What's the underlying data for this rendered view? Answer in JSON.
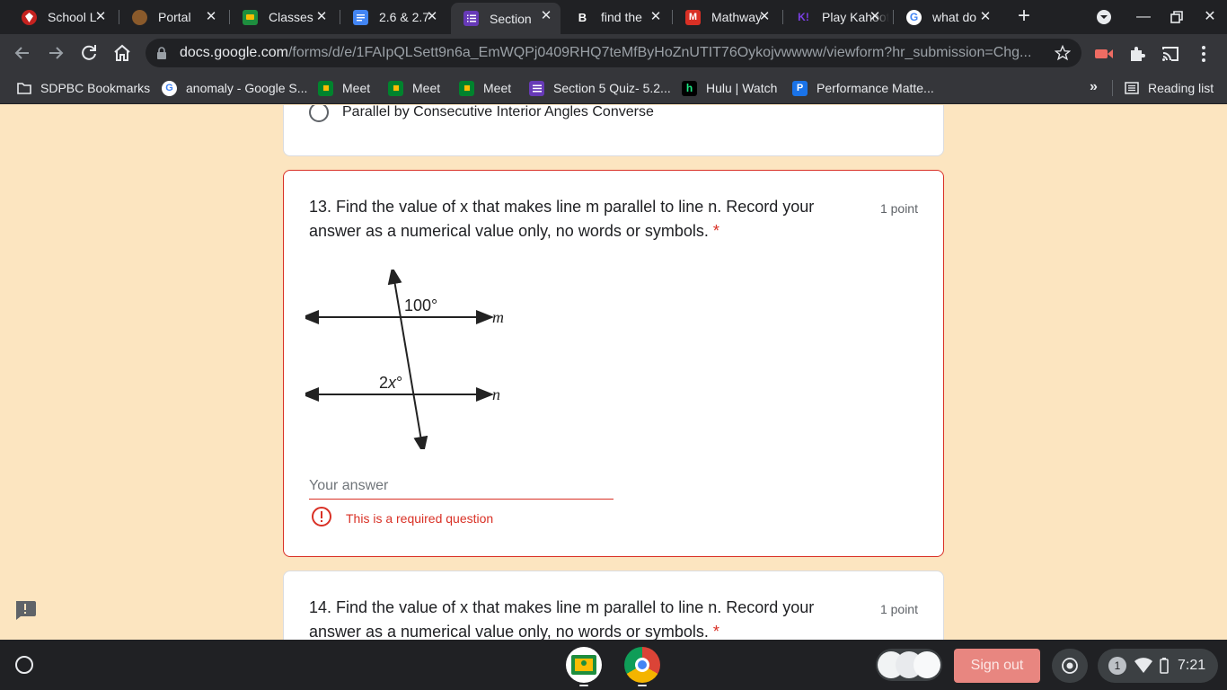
{
  "tabs": [
    {
      "title": "School L",
      "icon": "school-favicon",
      "color": "#c5221f",
      "active": false
    },
    {
      "title": "Portal",
      "icon": "portal-favicon",
      "color": "#8a5a2b",
      "active": false
    },
    {
      "title": "Classes",
      "icon": "classroom-favicon",
      "color": "#1e8e3e",
      "active": false
    },
    {
      "title": "2.6 & 2.7",
      "icon": "docs-favicon",
      "color": "#4285f4",
      "active": false
    },
    {
      "title": "Section",
      "icon": "forms-favicon",
      "color": "#673ab7",
      "active": true
    },
    {
      "title": "find the",
      "icon": "brainly-favicon",
      "color": "#202124",
      "active": false
    },
    {
      "title": "Mathway",
      "icon": "mathway-favicon",
      "color": "#d93025",
      "active": false
    },
    {
      "title": "Play Kahoot",
      "icon": "kahoot-favicon",
      "color": "#46178f",
      "active": false
    },
    {
      "title": "what do",
      "icon": "google-favicon",
      "color": "#ffffff",
      "active": false
    }
  ],
  "url": {
    "host": "docs.google.com",
    "path": "/forms/d/e/1FAIpQLSett9n6a_EmWQPj0409RHQ7teMfByHoZnUTIT76Oykojvwwww/viewform?hr_submission=Chg..."
  },
  "bookmarks": [
    {
      "label": "SDPBC Bookmarks",
      "icon": "folder-icon"
    },
    {
      "label": "anomaly - Google S...",
      "icon": "google-icon"
    },
    {
      "label": "Meet",
      "icon": "meet-icon"
    },
    {
      "label": "Meet",
      "icon": "meet-icon"
    },
    {
      "label": "Meet",
      "icon": "meet-icon"
    },
    {
      "label": "Section 5 Quiz- 5.2...",
      "icon": "forms-icon"
    },
    {
      "label": "Hulu | Watch",
      "icon": "hulu-icon"
    },
    {
      "label": "Performance Matte...",
      "icon": "pm-icon"
    }
  ],
  "bookmarks_more": "»",
  "reading_list": "Reading list",
  "prev_question": {
    "option_label": "Parallel by Consecutive Interior Angles Converse"
  },
  "q13": {
    "text": "13. Find the value of x that makes line m parallel to line n. Record your answer as a numerical value only, no words or symbols.",
    "required_mark": "*",
    "points": "1 point",
    "diagram": {
      "angle_top": "100°",
      "angle_bottom_coef": "2",
      "angle_bottom_var": "x",
      "angle_bottom_deg": "°",
      "line_top": "m",
      "line_bottom": "n"
    },
    "placeholder": "Your answer",
    "error": "This is a required question"
  },
  "q14": {
    "text": "14. Find the value of x that makes line m parallel to line n. Record your answer as a numerical value only, no words or symbols.",
    "required_mark": "*",
    "points": "1 point"
  },
  "shelf": {
    "signout": "Sign out",
    "notification_count": "1",
    "time": "7:21"
  },
  "colors": {
    "page_bg": "#fce5c0",
    "error": "#d93025",
    "chrome_dark": "#202124",
    "toolbar": "#35363a"
  }
}
